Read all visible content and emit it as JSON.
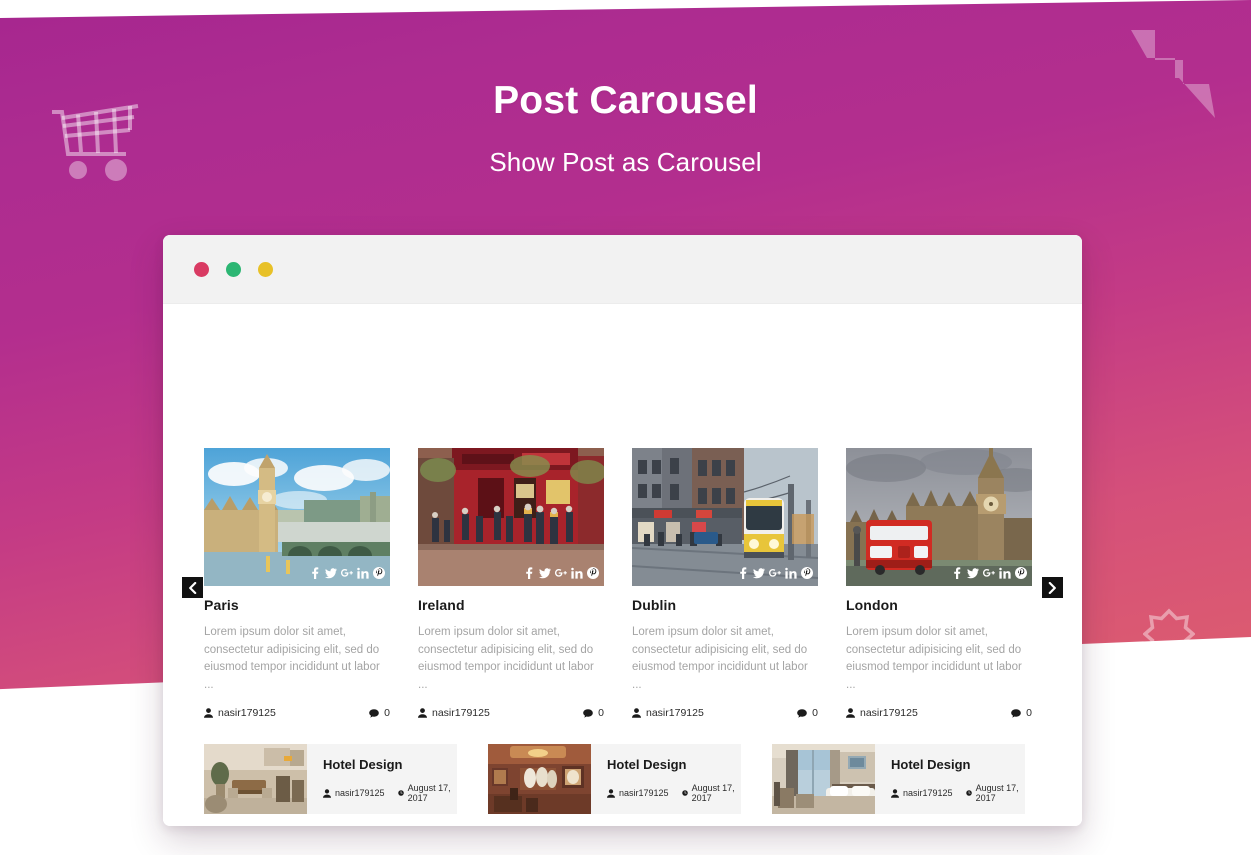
{
  "hero": {
    "title": "Post Carousel",
    "subtitle": "Show Post as Carousel"
  },
  "decorations": [
    {
      "name": "shopping-cart-icon"
    },
    {
      "name": "lightning-bolt-icon"
    },
    {
      "name": "eight-point-star-icon"
    }
  ],
  "browser": {
    "dots": [
      {
        "name": "close-dot",
        "color": "#d93b63"
      },
      {
        "name": "minimize-dot",
        "color": "#2cb673"
      },
      {
        "name": "maximize-dot",
        "color": "#e8c128"
      }
    ]
  },
  "carousel": {
    "prev_label": "‹",
    "next_label": "›",
    "social_icons": [
      "facebook-icon",
      "twitter-icon",
      "google-plus-icon",
      "linkedin-icon",
      "pinterest-icon"
    ],
    "posts": [
      {
        "title": "Paris",
        "excerpt": "Lorem ipsum dolor sit amet, consectetur adipisicing elit, sed do eiusmod tempor incididunt ut labor ...",
        "author": "nasir179125",
        "comments": "0",
        "image_alt": "big-ben-westminster-bridge"
      },
      {
        "title": "Ireland",
        "excerpt": "Lorem ipsum dolor sit amet, consectetur adipisicing elit, sed do eiusmod tempor incididunt ut labor ...",
        "author": "nasir179125",
        "comments": "0",
        "image_alt": "temple-bar-red-pub"
      },
      {
        "title": "Dublin",
        "excerpt": "Lorem ipsum dolor sit amet, consectetur adipisicing elit, sed do eiusmod tempor incididunt ut labor ...",
        "author": "nasir179125",
        "comments": "0",
        "image_alt": "city-street-tram"
      },
      {
        "title": "London",
        "excerpt": "Lorem ipsum dolor sit amet, consectetur adipisicing elit, sed do eiusmod tempor incididunt ut labor ...",
        "author": "nasir179125",
        "comments": "0",
        "image_alt": "red-bus-big-ben"
      }
    ]
  },
  "hotel_list": {
    "items": [
      {
        "title": "Hotel Design",
        "author": "nasir179125",
        "date": "August 17, 2017",
        "image_alt": "hotel-lounge-interior"
      },
      {
        "title": "Hotel Design",
        "author": "nasir179125",
        "date": "August 17, 2017",
        "image_alt": "hotel-dining-room"
      },
      {
        "title": "Hotel Design",
        "author": "nasir179125",
        "date": "August 17, 2017",
        "image_alt": "hotel-bedroom-window"
      }
    ]
  },
  "colors": {
    "gradient_start": "#a6268f",
    "gradient_end": "#dd5f6c",
    "arrow_bg": "#111111",
    "card_bg": "#f4f4f4"
  }
}
